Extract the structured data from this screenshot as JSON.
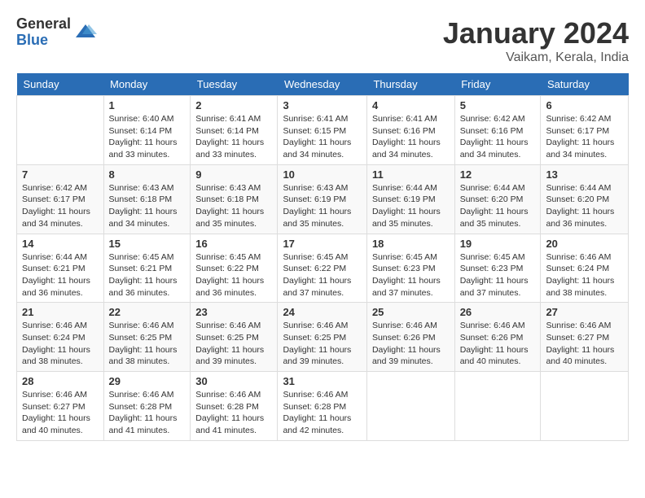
{
  "logo": {
    "general": "General",
    "blue": "Blue"
  },
  "title": "January 2024",
  "location": "Vaikam, Kerala, India",
  "weekdays": [
    "Sunday",
    "Monday",
    "Tuesday",
    "Wednesday",
    "Thursday",
    "Friday",
    "Saturday"
  ],
  "weeks": [
    [
      {
        "day": "",
        "sunrise": "",
        "sunset": "",
        "daylight": ""
      },
      {
        "day": "1",
        "sunrise": "6:40 AM",
        "sunset": "6:14 PM",
        "daylight": "11 hours and 33 minutes."
      },
      {
        "day": "2",
        "sunrise": "6:41 AM",
        "sunset": "6:14 PM",
        "daylight": "11 hours and 33 minutes."
      },
      {
        "day": "3",
        "sunrise": "6:41 AM",
        "sunset": "6:15 PM",
        "daylight": "11 hours and 34 minutes."
      },
      {
        "day": "4",
        "sunrise": "6:41 AM",
        "sunset": "6:16 PM",
        "daylight": "11 hours and 34 minutes."
      },
      {
        "day": "5",
        "sunrise": "6:42 AM",
        "sunset": "6:16 PM",
        "daylight": "11 hours and 34 minutes."
      },
      {
        "day": "6",
        "sunrise": "6:42 AM",
        "sunset": "6:17 PM",
        "daylight": "11 hours and 34 minutes."
      }
    ],
    [
      {
        "day": "7",
        "sunrise": "6:42 AM",
        "sunset": "6:17 PM",
        "daylight": "11 hours and 34 minutes."
      },
      {
        "day": "8",
        "sunrise": "6:43 AM",
        "sunset": "6:18 PM",
        "daylight": "11 hours and 34 minutes."
      },
      {
        "day": "9",
        "sunrise": "6:43 AM",
        "sunset": "6:18 PM",
        "daylight": "11 hours and 35 minutes."
      },
      {
        "day": "10",
        "sunrise": "6:43 AM",
        "sunset": "6:19 PM",
        "daylight": "11 hours and 35 minutes."
      },
      {
        "day": "11",
        "sunrise": "6:44 AM",
        "sunset": "6:19 PM",
        "daylight": "11 hours and 35 minutes."
      },
      {
        "day": "12",
        "sunrise": "6:44 AM",
        "sunset": "6:20 PM",
        "daylight": "11 hours and 35 minutes."
      },
      {
        "day": "13",
        "sunrise": "6:44 AM",
        "sunset": "6:20 PM",
        "daylight": "11 hours and 36 minutes."
      }
    ],
    [
      {
        "day": "14",
        "sunrise": "6:44 AM",
        "sunset": "6:21 PM",
        "daylight": "11 hours and 36 minutes."
      },
      {
        "day": "15",
        "sunrise": "6:45 AM",
        "sunset": "6:21 PM",
        "daylight": "11 hours and 36 minutes."
      },
      {
        "day": "16",
        "sunrise": "6:45 AM",
        "sunset": "6:22 PM",
        "daylight": "11 hours and 36 minutes."
      },
      {
        "day": "17",
        "sunrise": "6:45 AM",
        "sunset": "6:22 PM",
        "daylight": "11 hours and 37 minutes."
      },
      {
        "day": "18",
        "sunrise": "6:45 AM",
        "sunset": "6:23 PM",
        "daylight": "11 hours and 37 minutes."
      },
      {
        "day": "19",
        "sunrise": "6:45 AM",
        "sunset": "6:23 PM",
        "daylight": "11 hours and 37 minutes."
      },
      {
        "day": "20",
        "sunrise": "6:46 AM",
        "sunset": "6:24 PM",
        "daylight": "11 hours and 38 minutes."
      }
    ],
    [
      {
        "day": "21",
        "sunrise": "6:46 AM",
        "sunset": "6:24 PM",
        "daylight": "11 hours and 38 minutes."
      },
      {
        "day": "22",
        "sunrise": "6:46 AM",
        "sunset": "6:25 PM",
        "daylight": "11 hours and 38 minutes."
      },
      {
        "day": "23",
        "sunrise": "6:46 AM",
        "sunset": "6:25 PM",
        "daylight": "11 hours and 39 minutes."
      },
      {
        "day": "24",
        "sunrise": "6:46 AM",
        "sunset": "6:25 PM",
        "daylight": "11 hours and 39 minutes."
      },
      {
        "day": "25",
        "sunrise": "6:46 AM",
        "sunset": "6:26 PM",
        "daylight": "11 hours and 39 minutes."
      },
      {
        "day": "26",
        "sunrise": "6:46 AM",
        "sunset": "6:26 PM",
        "daylight": "11 hours and 40 minutes."
      },
      {
        "day": "27",
        "sunrise": "6:46 AM",
        "sunset": "6:27 PM",
        "daylight": "11 hours and 40 minutes."
      }
    ],
    [
      {
        "day": "28",
        "sunrise": "6:46 AM",
        "sunset": "6:27 PM",
        "daylight": "11 hours and 40 minutes."
      },
      {
        "day": "29",
        "sunrise": "6:46 AM",
        "sunset": "6:28 PM",
        "daylight": "11 hours and 41 minutes."
      },
      {
        "day": "30",
        "sunrise": "6:46 AM",
        "sunset": "6:28 PM",
        "daylight": "11 hours and 41 minutes."
      },
      {
        "day": "31",
        "sunrise": "6:46 AM",
        "sunset": "6:28 PM",
        "daylight": "11 hours and 42 minutes."
      },
      {
        "day": "",
        "sunrise": "",
        "sunset": "",
        "daylight": ""
      },
      {
        "day": "",
        "sunrise": "",
        "sunset": "",
        "daylight": ""
      },
      {
        "day": "",
        "sunrise": "",
        "sunset": "",
        "daylight": ""
      }
    ]
  ]
}
